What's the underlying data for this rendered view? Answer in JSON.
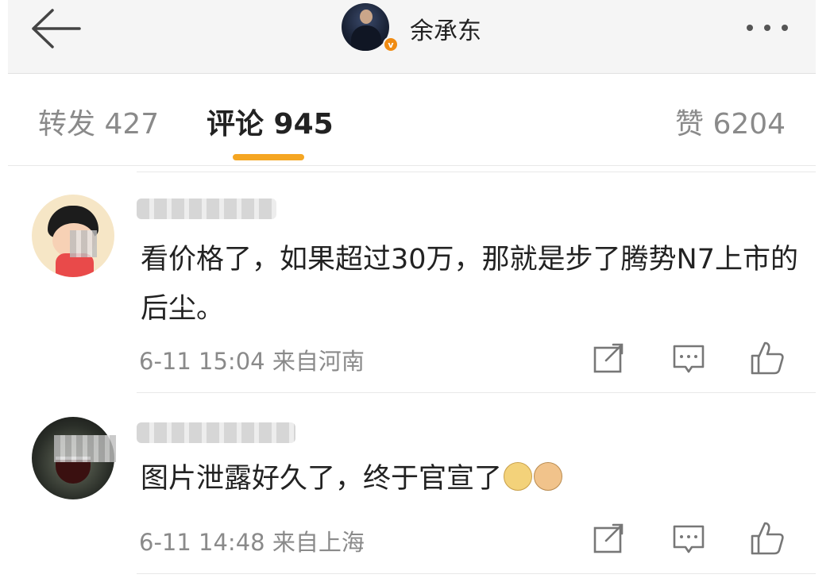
{
  "header": {
    "username": "余承东",
    "verified_badge": "v",
    "back_icon": "arrow-left-icon",
    "more_icon": "more-horizontal-icon"
  },
  "tabs": [
    {
      "label": "转发 427",
      "active": false
    },
    {
      "label": "评论 945",
      "active": true
    },
    {
      "label": "赞 6204",
      "active": false
    }
  ],
  "comments": [
    {
      "text": "看价格了，如果超过30万，那就是步了腾势N7上市的后尘。",
      "meta": "6-11 15:04 来自河南"
    },
    {
      "text": "图片泄露好久了，终于官宣了",
      "emojis": [
        "doge-emoji",
        "cat-emoji"
      ],
      "meta": "6-11 14:48 来自上海"
    }
  ],
  "colors": {
    "accent": "#f5a623",
    "badge": "#f08b12",
    "muted": "#8a8a8a"
  }
}
